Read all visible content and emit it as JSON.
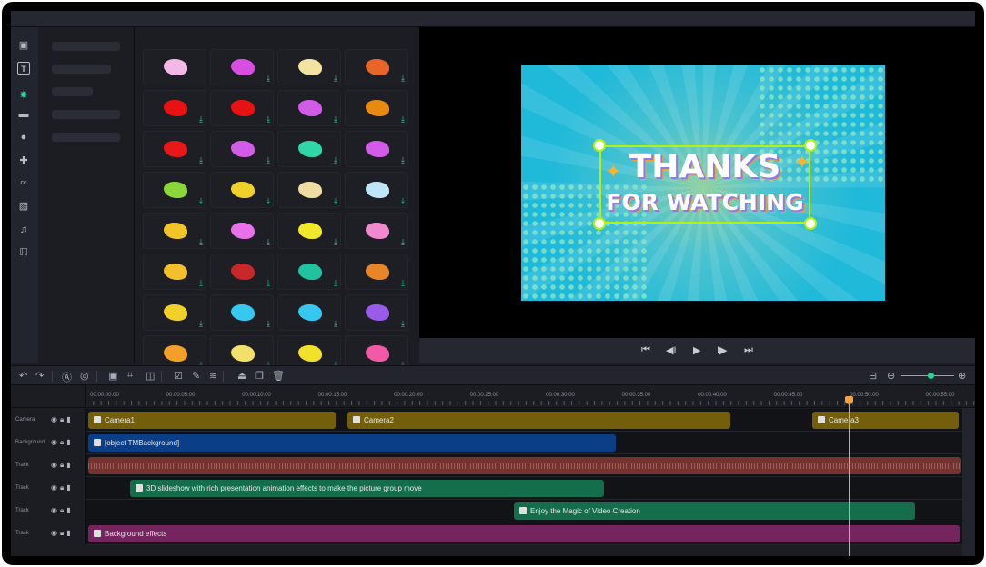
{
  "sidebar": {
    "icons": [
      "media-icon",
      "text-icon",
      "sticker-icon",
      "folder-icon",
      "avatar-icon",
      "plugin-icon",
      "caption-icon",
      "filter-icon",
      "music-icon",
      "template-icon"
    ]
  },
  "stickers": {
    "colors": [
      "#f2b8e6",
      "#d84ee0",
      "#f3e3a0",
      "#e8652a",
      "#e81212",
      "#e81212",
      "#d25ce8",
      "#e88a12",
      "#e81818",
      "#d25ce8",
      "#2fd6a8",
      "#d25ce8",
      "#8bd63a",
      "#f0d02a",
      "#f0dca0",
      "#bfe6f7",
      "#f2c42a",
      "#e870e8",
      "#f2e82a",
      "#f08ad0",
      "#f2c02a",
      "#c82828",
      "#21c2a0",
      "#e8842a",
      "#f2d02a",
      "#36c8f0",
      "#36c8f0",
      "#9a5ce8",
      "#f2a02a",
      "#f2e06a",
      "#f2e02a",
      "#f25aa8"
    ]
  },
  "preview": {
    "title_line1": "THANKS",
    "title_line2": "FOR WATCHING"
  },
  "player": {
    "buttons": [
      "skip-start",
      "prev-frame",
      "play",
      "next-frame",
      "skip-end"
    ]
  },
  "ruler": {
    "labels": [
      "00:00:00:00",
      "00:00:05:00",
      "00:00:10:00",
      "00:00:15:00",
      "00:00:20:00",
      "00:00:25:00",
      "00:00:30:00",
      "00:00:35:00",
      "00:00:40:00",
      "00:00:45:00",
      "00:00:50:00",
      "00:00:55:00"
    ]
  },
  "tracks": [
    {
      "label": "Camera",
      "clips": [
        {
          "text": "Camera1"
        },
        {
          "text": "Camera2"
        },
        {
          "text": "Camera3"
        }
      ]
    },
    {
      "label": "Background",
      "clips": [
        {
          "text": "[object TMBackground]"
        }
      ]
    },
    {
      "label": "Track",
      "clips": []
    },
    {
      "label": "Track",
      "clips": [
        {
          "text": "3D slideshow with rich presentation animation effects to make the picture group move"
        }
      ]
    },
    {
      "label": "Track",
      "clips": [
        {
          "text": "Enjoy the Magic of Video Creation"
        }
      ]
    },
    {
      "label": "Track",
      "clips": [
        {
          "text": "Background effects"
        }
      ]
    }
  ],
  "zoom": {
    "level": 0.55
  },
  "colors": {
    "camera": "#735f0b",
    "background": "#0a3f88",
    "audio": "#74332f",
    "text": "#146e4c",
    "effects": "#74255d",
    "playhead": "#f7a340",
    "accent": "#2fd39a"
  }
}
